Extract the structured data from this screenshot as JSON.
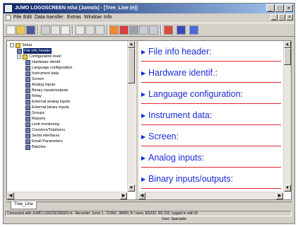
{
  "window": {
    "title": "JUMO LOGOSCREEN nt/ui (Jumo/x) - [Tree_Line (e)]",
    "controls": [
      "_",
      "□",
      "×"
    ]
  },
  "menubar": {
    "items": [
      "File",
      "Edit",
      "Data transfer",
      "Extras",
      "Window",
      "Info"
    ],
    "mdi_controls": [
      "_",
      "□",
      "×"
    ]
  },
  "toolbar": {
    "buttons": [
      "new-icon",
      "open-icon",
      "save-icon",
      "print-icon",
      "cut-icon",
      "copy-icon",
      "paste-icon",
      "undo-icon",
      "redo-icon",
      "transfer-icon",
      "record-icon",
      "settings-icon",
      "zoom-in-icon",
      "zoom-out-icon",
      "chart-icon",
      "filter-icon",
      "list-icon"
    ]
  },
  "tree": {
    "root": "Setup",
    "items": [
      {
        "label": "File info header",
        "selected": true
      },
      {
        "label": "Configuration level",
        "selected": false
      },
      {
        "label": "Hardware identif.",
        "selected": false
      },
      {
        "label": "Language configuration",
        "selected": false
      },
      {
        "label": "Instrument data",
        "selected": false
      },
      {
        "label": "Screen",
        "selected": false
      },
      {
        "label": "Analog inputs",
        "selected": false
      },
      {
        "label": "Binary inputs/outputs",
        "selected": false
      },
      {
        "label": "Relay",
        "selected": false
      },
      {
        "label": "External analog inputs",
        "selected": false
      },
      {
        "label": "External binary inputs",
        "selected": false
      },
      {
        "label": "Groups",
        "selected": false
      },
      {
        "label": "Reports",
        "selected": false
      },
      {
        "label": "Limit monitoring",
        "selected": false
      },
      {
        "label": "Counters/Totalizers",
        "selected": false
      },
      {
        "label": "Serial interfaces",
        "selected": false
      },
      {
        "label": "Email Parameters",
        "selected": false
      },
      {
        "label": "Batches",
        "selected": false
      }
    ]
  },
  "document": {
    "sections": [
      "File info header:",
      "Hardware identif.:",
      "Language configuration:",
      "Instrument data:",
      "Screen:",
      "Analog inputs:",
      "Binary inputs/outputs:"
    ]
  },
  "tabs": [
    "Tree_Line"
  ],
  "status": {
    "line1": "Connected with JUMO LOGOSCREEN nt - Recorder: Jumo 1 - COM1: 38400, 8 / none, RS232, RS 232, logged in with ID",
    "line2": "User: Specialist"
  },
  "colors": {
    "title_gradient_start": "#0a246a",
    "section_text": "#1a2ad8",
    "section_rule": "#e0282e",
    "selection": "#0a246a"
  }
}
